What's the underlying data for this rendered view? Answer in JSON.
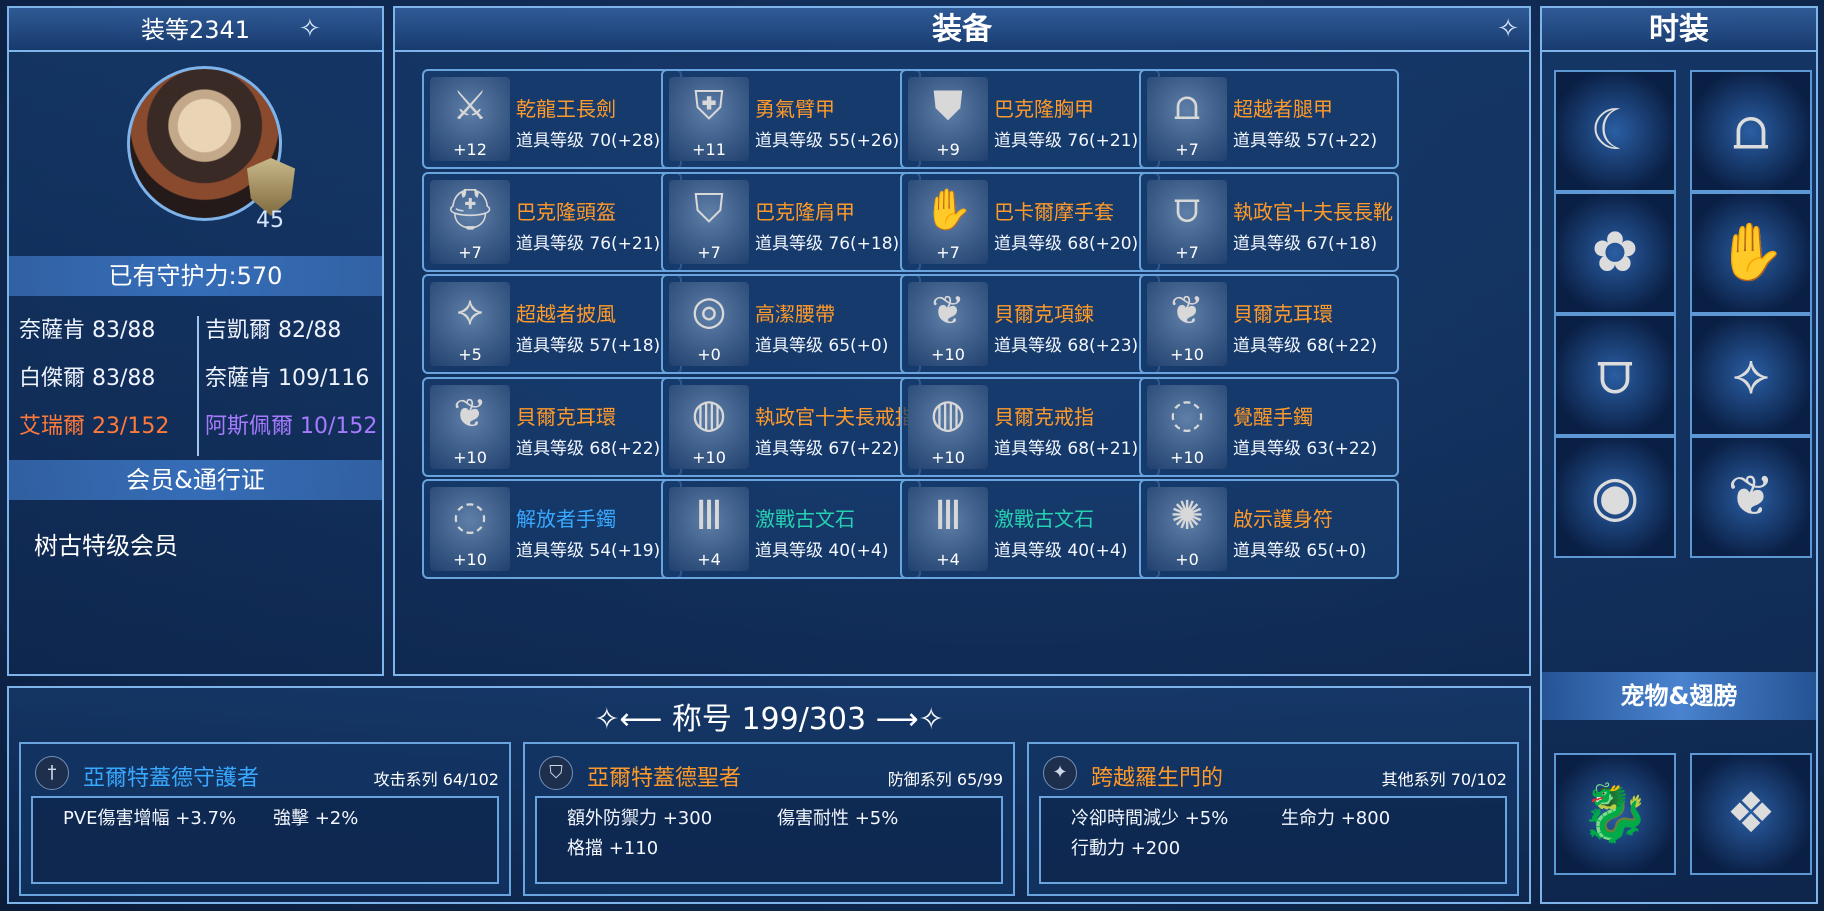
{
  "left_panel": {
    "level_title": "装等2341",
    "level_badge": "45",
    "guard_power": "已有守护力:570",
    "stats": [
      {
        "text": "奈薩肯 83/88",
        "color": "default"
      },
      {
        "text": "吉凱爾 82/88",
        "color": "default"
      },
      {
        "text": "白傑爾 83/88",
        "color": "default"
      },
      {
        "text": "奈薩肯 109/116",
        "color": "default"
      },
      {
        "text": "艾瑞爾 23/152",
        "color": "red"
      },
      {
        "text": "阿斯佩爾 10/152",
        "color": "purple"
      }
    ],
    "membership_header": "会员&通行证",
    "membership_value": "树古特级会员"
  },
  "equipment": {
    "title": "装备",
    "items": [
      {
        "name": "乾龍王長劍",
        "level": "道具等级 70(+28)",
        "enhance": "+12",
        "icon": "sword-icon",
        "color": "orange"
      },
      {
        "name": "勇氣臂甲",
        "level": "道具等级 55(+26)",
        "enhance": "+11",
        "icon": "arm-guard-icon",
        "color": "orange"
      },
      {
        "name": "巴克隆胸甲",
        "level": "道具等级 76(+21)",
        "enhance": "+9",
        "icon": "chest-armor-icon",
        "color": "orange"
      },
      {
        "name": "超越者腿甲",
        "level": "道具等级 57(+22)",
        "enhance": "+7",
        "icon": "leg-armor-icon",
        "color": "orange"
      },
      {
        "name": "巴克隆頭盔",
        "level": "道具等级 76(+21)",
        "enhance": "+7",
        "icon": "helmet-icon",
        "color": "orange"
      },
      {
        "name": "巴克隆肩甲",
        "level": "道具等级 76(+18)",
        "enhance": "+7",
        "icon": "shoulder-armor-icon",
        "color": "orange"
      },
      {
        "name": "巴卡爾摩手套",
        "level": "道具等级 68(+20)",
        "enhance": "+7",
        "icon": "gloves-icon",
        "color": "orange"
      },
      {
        "name": "執政官十夫長長靴",
        "level": "道具等级 67(+18)",
        "enhance": "+7",
        "icon": "boots-icon",
        "color": "orange"
      },
      {
        "name": "超越者披風",
        "level": "道具等级 57(+18)",
        "enhance": "+5",
        "icon": "cape-icon",
        "color": "orange"
      },
      {
        "name": "高潔腰帶",
        "level": "道具等级 65(+0)",
        "enhance": "+0",
        "icon": "belt-icon",
        "color": "orange"
      },
      {
        "name": "貝爾克項鍊",
        "level": "道具等级 68(+23)",
        "enhance": "+10",
        "icon": "necklace-icon",
        "color": "orange"
      },
      {
        "name": "貝爾克耳環",
        "level": "道具等级 68(+22)",
        "enhance": "+10",
        "icon": "earring-icon",
        "color": "orange"
      },
      {
        "name": "貝爾克耳環",
        "level": "道具等级 68(+22)",
        "enhance": "+10",
        "icon": "earring-icon",
        "color": "orange"
      },
      {
        "name": "執政官十夫長戒指",
        "level": "道具等级 67(+22)",
        "enhance": "+10",
        "icon": "ring-icon",
        "color": "orange"
      },
      {
        "name": "貝爾克戒指",
        "level": "道具等级 68(+21)",
        "enhance": "+10",
        "icon": "ring-icon",
        "color": "orange"
      },
      {
        "name": "覺醒手鐲",
        "level": "道具等级 63(+22)",
        "enhance": "+10",
        "icon": "bracelet-icon",
        "color": "orange"
      },
      {
        "name": "解放者手鐲",
        "level": "道具等级 54(+19)",
        "enhance": "+10",
        "icon": "bracelet-icon",
        "color": "blue"
      },
      {
        "name": "激戰古文石",
        "level": "道具等级 40(+4)",
        "enhance": "+4",
        "icon": "rune-stone-icon",
        "color": "green"
      },
      {
        "name": "激戰古文石",
        "level": "道具等级 40(+4)",
        "enhance": "+4",
        "icon": "rune-stone-icon",
        "color": "green"
      },
      {
        "name": "啟示護身符",
        "level": "道具等级 65(+0)",
        "enhance": "+0",
        "icon": "amulet-icon",
        "color": "orange"
      }
    ]
  },
  "fashion": {
    "title": "时装",
    "items": [
      {
        "icon": "headgear-icon",
        "glyph": "☾"
      },
      {
        "icon": "pants-icon",
        "glyph": "⩍"
      },
      {
        "icon": "hair-ornament-icon",
        "glyph": "✿"
      },
      {
        "icon": "gloves-icon",
        "glyph": "✋"
      },
      {
        "icon": "boots-icon",
        "glyph": "⩌"
      },
      {
        "icon": "cape-icon",
        "glyph": "⟡"
      },
      {
        "icon": "mask-icon",
        "glyph": "◉"
      },
      {
        "icon": "wing-ornament-icon",
        "glyph": "❦"
      }
    ],
    "pet_wing_header": "宠物&翅膀",
    "pets": [
      {
        "icon": "dragon-pet-icon",
        "glyph": "🐉"
      },
      {
        "icon": "wings-icon",
        "glyph": "❖"
      }
    ]
  },
  "titles": {
    "header": "称号 199/303",
    "cards": [
      {
        "name": "亞爾特蓋德守護者",
        "series": "攻击系列 64/102",
        "icon": "sword-emblem-icon",
        "color": "blue",
        "stats": [
          "PVE傷害增幅 +3.7%",
          "強擊 +2%"
        ]
      },
      {
        "name": "亞爾特蓋德聖者",
        "series": "防御系列 65/99",
        "icon": "shield-emblem-icon",
        "color": "orange",
        "stats": [
          "額外防禦力 +300",
          "傷害耐性 +5%",
          "格擋 +110"
        ]
      },
      {
        "name": "跨越羅生門的",
        "series": "其他系列 70/102",
        "icon": "star-emblem-icon",
        "color": "orange",
        "stats": [
          "冷卻時間減少 +5%",
          "生命力 +800",
          "行動力 +200"
        ]
      }
    ]
  },
  "colors": {
    "orange": "#ff9a2a",
    "blue": "#39a8ff",
    "green": "#27d0b0",
    "red": "#ff7a3a",
    "purple": "#a77bff",
    "border": "#7fb4ea"
  }
}
